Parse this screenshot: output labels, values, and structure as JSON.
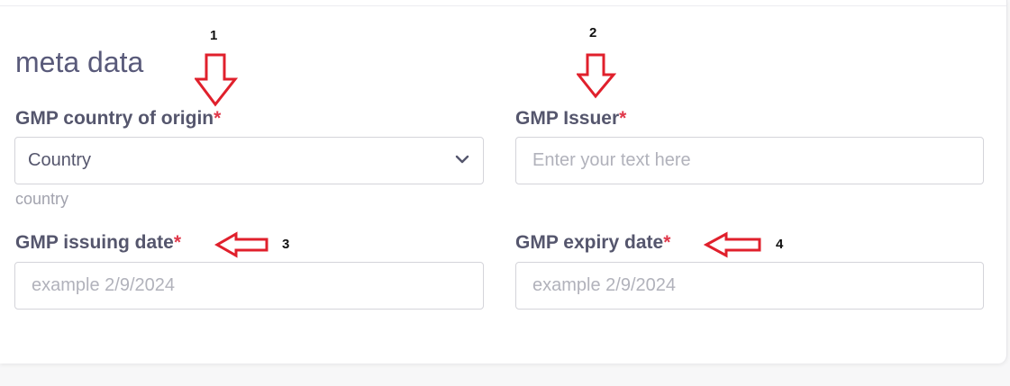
{
  "section": {
    "title": "meta data"
  },
  "fields": {
    "country_of_origin": {
      "label": "GMP country of origin",
      "required_mark": "*",
      "selected_value": "Country",
      "helper_text": "country"
    },
    "issuer": {
      "label": "GMP Issuer",
      "required_mark": "*",
      "placeholder": "Enter your text here"
    },
    "issuing_date": {
      "label": "GMP issuing date",
      "required_mark": "*",
      "placeholder": "example 2/9/2024"
    },
    "expiry_date": {
      "label": "GMP expiry date",
      "required_mark": "*",
      "placeholder": "example 2/9/2024"
    }
  },
  "annotations": [
    {
      "number": "1",
      "direction": "down"
    },
    {
      "number": "2",
      "direction": "down"
    },
    {
      "number": "3",
      "direction": "left"
    },
    {
      "number": "4",
      "direction": "left"
    }
  ],
  "colors": {
    "annotation_arrow": "#e0202c",
    "required_asterisk": "#e0384a",
    "label_text": "#55566d"
  },
  "icons": {
    "select_chevron": "chevron-down-icon",
    "annotation_arrow_down": "arrow-down-outline-icon",
    "annotation_arrow_left": "arrow-left-outline-icon"
  }
}
